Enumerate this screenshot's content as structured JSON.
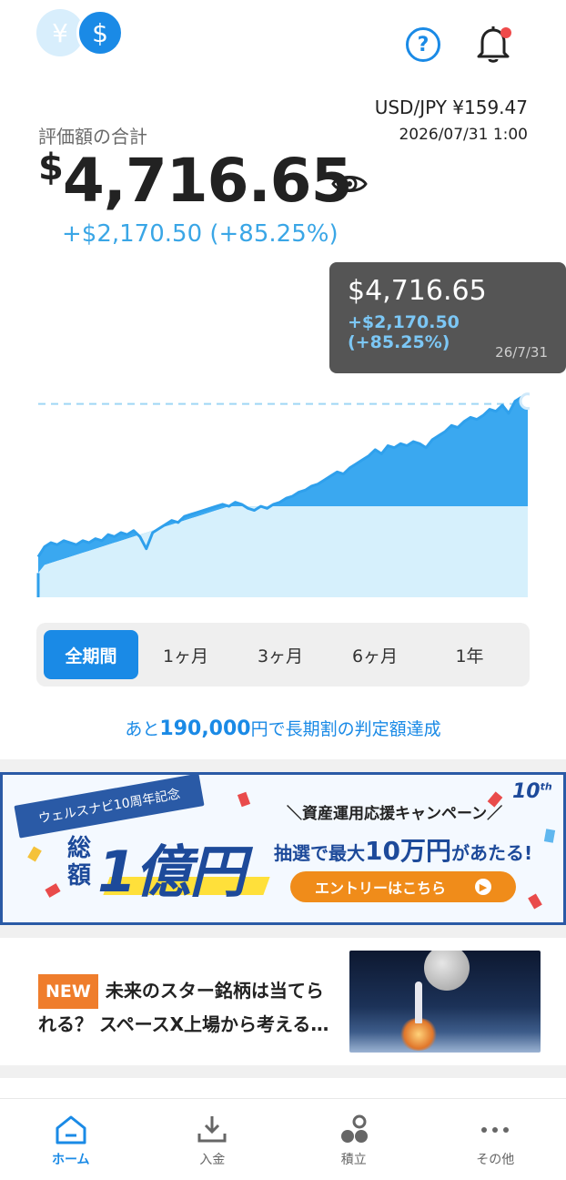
{
  "header": {
    "currency_yen": "¥",
    "currency_usd": "$",
    "fx_rate": "USD/JPY ¥159.47",
    "fx_time": "2026/07/31 1:00"
  },
  "summary": {
    "label": "評価額の合計",
    "currency_symbol": "$",
    "value": "4,716.65",
    "gain": "+$2,170.50 (+85.25%)"
  },
  "tooltip": {
    "value": "$4,716.65",
    "gain": "+$2,170.50 (+85.25%)",
    "date": "26/7/31"
  },
  "chart_data": {
    "type": "area",
    "title": "",
    "xlabel": "",
    "ylabel": "",
    "principal_level": 0.45,
    "last_value_level": 0.97,
    "series": [
      {
        "values": [
          0.2,
          0.25,
          0.27,
          0.26,
          0.28,
          0.27,
          0.26,
          0.28,
          0.27,
          0.29,
          0.28,
          0.31,
          0.3,
          0.32,
          0.31,
          0.33,
          0.3,
          0.24,
          0.32,
          0.34,
          0.36,
          0.38,
          0.37,
          0.4,
          0.41,
          0.42,
          0.43,
          0.44,
          0.45,
          0.46,
          0.45,
          0.47,
          0.46,
          0.44,
          0.43,
          0.45,
          0.44,
          0.46,
          0.47,
          0.49,
          0.5,
          0.52,
          0.53,
          0.55,
          0.56,
          0.58,
          0.6,
          0.62,
          0.61,
          0.64,
          0.66,
          0.68,
          0.7,
          0.73,
          0.71,
          0.75,
          0.74,
          0.76,
          0.75,
          0.77,
          0.76,
          0.74,
          0.78,
          0.8,
          0.82,
          0.85,
          0.84,
          0.87,
          0.89,
          0.88,
          0.9,
          0.93,
          0.92,
          0.95,
          0.91,
          0.97,
          0.99,
          0.97
        ]
      },
      {
        "values": [
          0.12,
          0.16,
          0.17,
          0.18,
          0.19,
          0.2,
          0.21,
          0.22,
          0.23,
          0.24,
          0.25,
          0.26,
          0.27,
          0.28,
          0.29,
          0.3,
          0.31,
          0.32,
          0.33,
          0.34,
          0.35,
          0.36,
          0.37,
          0.38,
          0.39,
          0.4,
          0.41,
          0.42,
          0.43,
          0.44,
          0.45,
          0.45,
          0.45,
          0.45,
          0.45,
          0.45,
          0.45,
          0.45,
          0.45,
          0.45,
          0.45,
          0.45,
          0.45,
          0.45,
          0.45,
          0.45,
          0.45,
          0.45,
          0.45,
          0.45,
          0.45,
          0.45,
          0.45,
          0.45,
          0.45,
          0.45,
          0.45,
          0.45,
          0.45,
          0.45,
          0.45,
          0.45,
          0.45,
          0.45,
          0.45,
          0.45,
          0.45,
          0.45,
          0.45,
          0.45,
          0.45,
          0.45,
          0.45,
          0.45,
          0.45,
          0.45,
          0.45,
          0.45
        ]
      }
    ]
  },
  "periods": {
    "all": "全期間",
    "m1": "1ヶ月",
    "m3": "3ヶ月",
    "m6": "6ヶ月",
    "y1": "1年"
  },
  "milestone": {
    "prefix": "あと",
    "amount": "190,000",
    "suffix": "円で長期割の判定額達成"
  },
  "banner": {
    "ribbon": "ウェルスナビ10周年記念",
    "sogaku": "総額",
    "oku": "1億円",
    "campaign": "＼資産運用応援キャンペーン／",
    "lottery_a": "抽選で最大",
    "lottery_b": "10万円",
    "lottery_c": "があたる!",
    "entry": "エントリーはこちら",
    "tenth": "10"
  },
  "news": {
    "badge": "NEW",
    "title": "未来のスター銘柄は当てられる？ スペースX上場から考える…"
  },
  "nav": {
    "home": "ホーム",
    "deposit": "入金",
    "accumulate": "積立",
    "other": "その他"
  }
}
